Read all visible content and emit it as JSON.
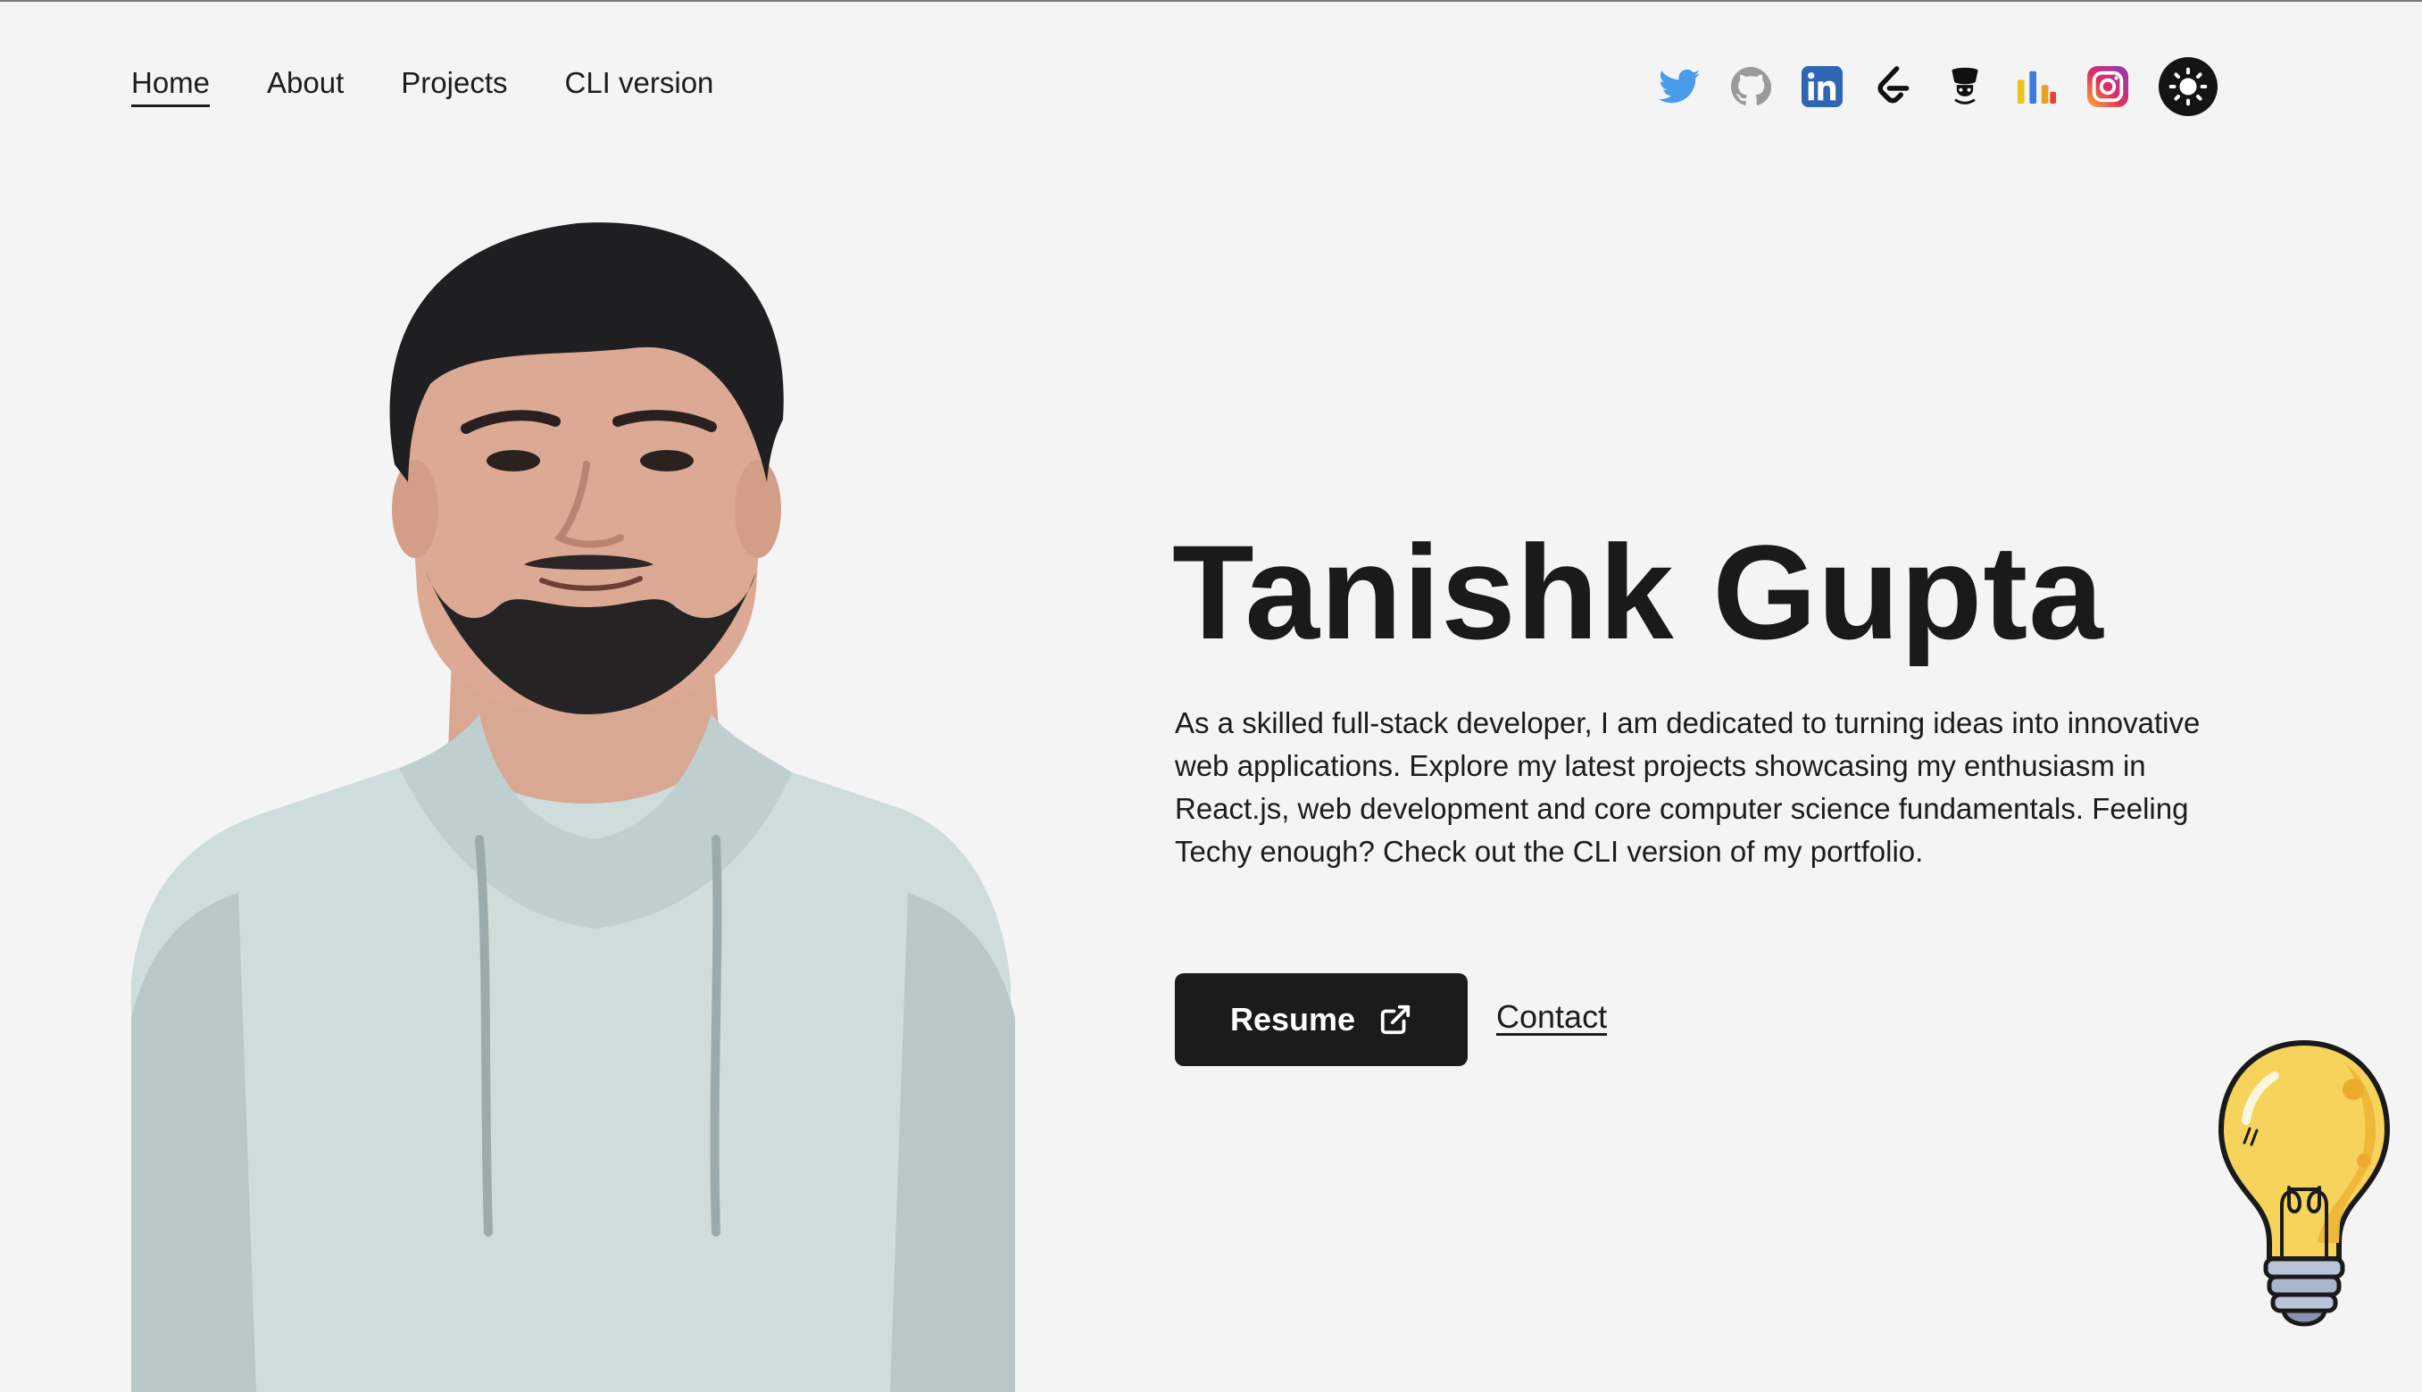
{
  "nav": {
    "items": [
      {
        "label": "Home",
        "active": true
      },
      {
        "label": "About",
        "active": false
      },
      {
        "label": "Projects",
        "active": false
      },
      {
        "label": "CLI version",
        "active": false
      }
    ]
  },
  "socials": [
    {
      "icon": "twitter-icon",
      "color": "#4a9be9"
    },
    {
      "icon": "github-icon",
      "color": "#9a9a9a"
    },
    {
      "icon": "linkedin-icon",
      "color": "#2f66b3"
    },
    {
      "icon": "leetcode-icon",
      "color": "#111111"
    },
    {
      "icon": "codechef-icon",
      "color": "#111111"
    },
    {
      "icon": "stats-icon",
      "color": "#e9a21f"
    },
    {
      "icon": "instagram-icon",
      "color": "#d92f7a"
    }
  ],
  "theme_toggle": {
    "icon": "sun-icon"
  },
  "hero": {
    "name": "Tanishk Gupta",
    "description": "As a skilled full-stack developer, I am dedicated to turning ideas into innovative web applications. Explore my latest projects showcasing my enthusiasm in React.js, web development and core computer science fundamentals. Feeling Techy enough? Check out the CLI version of my portfolio.",
    "resume_label": "Resume",
    "resume_icon": "external-link-icon",
    "contact_label": "Contact"
  },
  "decor": {
    "portrait": "profile-photo",
    "bulb": "lightbulb-icon"
  },
  "colors": {
    "background": "#f4f4f4",
    "text": "#1c1c1c",
    "button": "#1b1b1b",
    "bulb_yellow": "#f6d35a"
  }
}
